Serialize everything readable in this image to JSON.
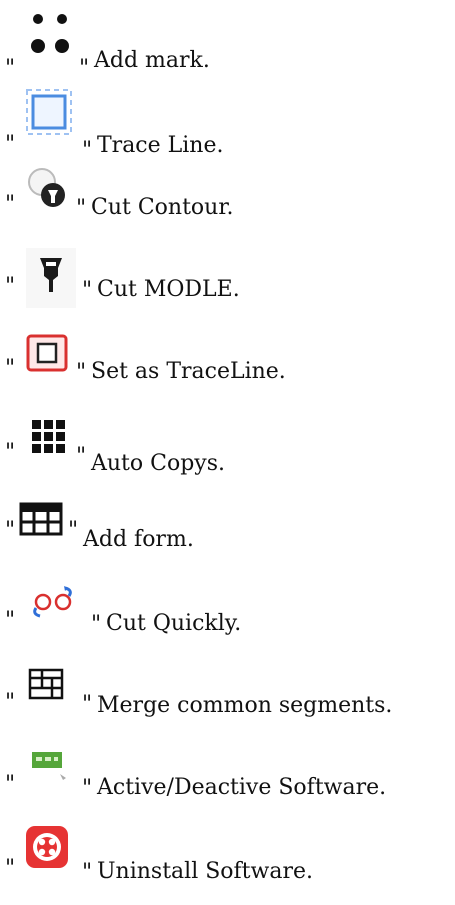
{
  "quote": "\"",
  "items": [
    {
      "icon": "four-dots-icon",
      "label": "Add mark."
    },
    {
      "icon": "trace-line-icon",
      "label": "Trace Line."
    },
    {
      "icon": "cut-contour-icon",
      "label": "Cut Contour."
    },
    {
      "icon": "cut-model-icon",
      "label": "Cut MODLE."
    },
    {
      "icon": "set-traceline-icon",
      "label": "Set as TraceLine."
    },
    {
      "icon": "auto-copy-grid-icon",
      "label": "Auto Copys."
    },
    {
      "icon": "add-form-table-icon",
      "label": "Add form."
    },
    {
      "icon": "cut-quickly-icon",
      "label": "Cut Quickly."
    },
    {
      "icon": "merge-segments-icon",
      "label": "Merge common segments."
    },
    {
      "icon": "active-software-icon",
      "label": "Active/Deactive Software."
    },
    {
      "icon": "uninstall-software-icon",
      "label": "Uninstall Software."
    }
  ],
  "colors": {
    "text": "#111111",
    "blue": "#2f6fd8",
    "red": "#d9302f"
  }
}
